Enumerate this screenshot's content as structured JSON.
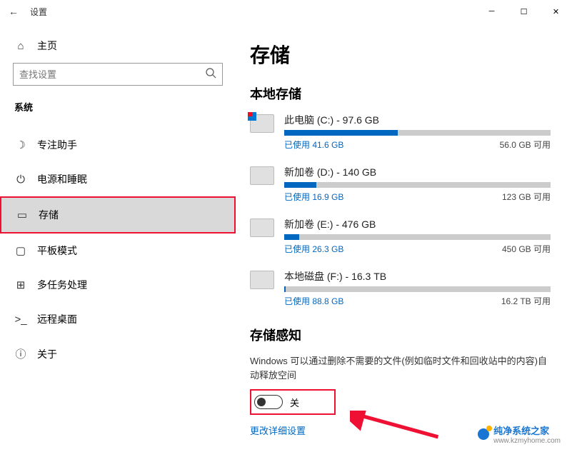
{
  "titlebar": {
    "title": "设置"
  },
  "sidebar": {
    "home": "主页",
    "search_placeholder": "查找设置",
    "category": "系统",
    "items": [
      {
        "label": "专注助手"
      },
      {
        "label": "电源和睡眠"
      },
      {
        "label": "存储"
      },
      {
        "label": "平板模式"
      },
      {
        "label": "多任务处理"
      },
      {
        "label": "远程桌面"
      },
      {
        "label": "关于"
      }
    ]
  },
  "main": {
    "title": "存储",
    "local_heading": "本地存储",
    "drives": [
      {
        "label": "此电脑 (C:) - 97.6 GB",
        "used_label": "已使用 41.6 GB",
        "free_label": "56.0 GB 可用",
        "fill_pct": 42.6
      },
      {
        "label": "新加卷 (D:) - 140 GB",
        "used_label": "已使用 16.9 GB",
        "free_label": "123 GB 可用",
        "fill_pct": 12.1
      },
      {
        "label": "新加卷 (E:) - 476 GB",
        "used_label": "已使用 26.3 GB",
        "free_label": "450 GB 可用",
        "fill_pct": 5.5
      },
      {
        "label": "本地磁盘 (F:) - 16.3 TB",
        "used_label": "已使用 88.8 GB",
        "free_label": "16.2 TB 可用",
        "fill_pct": 0.5
      }
    ],
    "sense_heading": "存储感知",
    "sense_desc": "Windows 可以通过删除不需要的文件(例如临时文件和回收站中的内容)自动释放空间",
    "toggle_state": "关",
    "more_link": "更改详细设置"
  },
  "watermark": {
    "brand": "纯净系统之家",
    "url": "www.kzmyhome.com"
  }
}
